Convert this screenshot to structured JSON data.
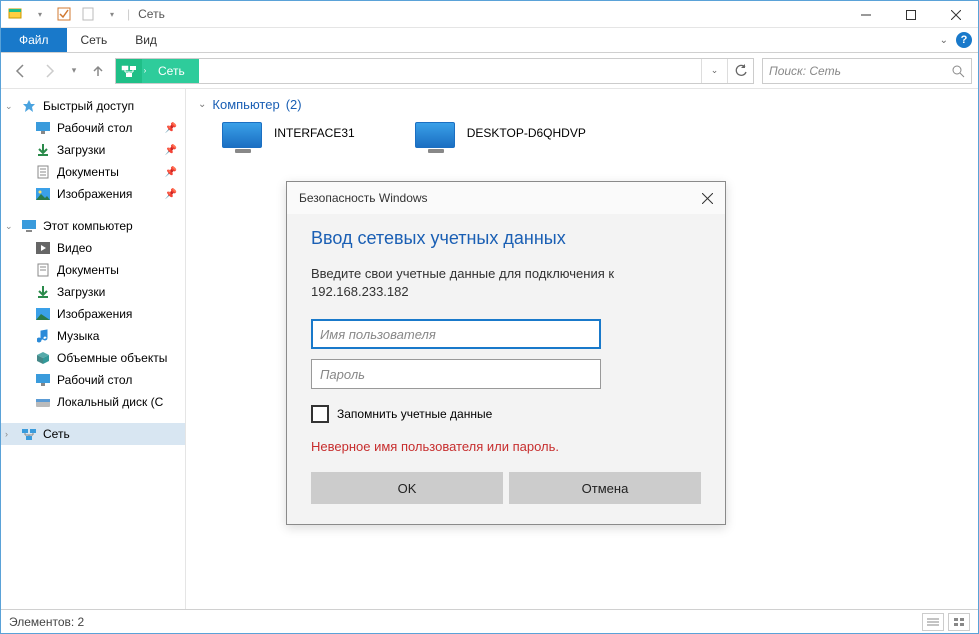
{
  "window": {
    "title": "Сеть"
  },
  "ribbon": {
    "file": "Файл",
    "tabs": [
      "Сеть",
      "Вид"
    ]
  },
  "nav": {
    "address_segment": "Сеть",
    "search_placeholder": "Поиск: Сеть"
  },
  "sidebar": {
    "quick_access": {
      "label": "Быстрый доступ",
      "items": [
        {
          "label": "Рабочий стол",
          "icon": "desktop",
          "pinned": true
        },
        {
          "label": "Загрузки",
          "icon": "download",
          "pinned": true
        },
        {
          "label": "Документы",
          "icon": "document",
          "pinned": true
        },
        {
          "label": "Изображения",
          "icon": "picture",
          "pinned": true
        }
      ]
    },
    "this_pc": {
      "label": "Этот компьютер",
      "items": [
        {
          "label": "Видео",
          "icon": "video"
        },
        {
          "label": "Документы",
          "icon": "document"
        },
        {
          "label": "Загрузки",
          "icon": "download"
        },
        {
          "label": "Изображения",
          "icon": "picture"
        },
        {
          "label": "Музыка",
          "icon": "music"
        },
        {
          "label": "Объемные объекты",
          "icon": "cube"
        },
        {
          "label": "Рабочий стол",
          "icon": "desktop"
        },
        {
          "label": "Локальный диск (C",
          "icon": "disk"
        }
      ]
    },
    "network": {
      "label": "Сеть"
    }
  },
  "main": {
    "category": "Компьютер",
    "category_count": "(2)",
    "computers": [
      {
        "name": "INTERFACE31"
      },
      {
        "name": "DESKTOP-D6QHDVP"
      }
    ]
  },
  "dialog": {
    "title": "Безопасность Windows",
    "heading": "Ввод сетевых учетных данных",
    "instruction_line1": "Введите свои учетные данные для подключения к",
    "instruction_line2": "192.168.233.182",
    "username_placeholder": "Имя пользователя",
    "password_placeholder": "Пароль",
    "remember_label": "Запомнить учетные данные",
    "error": "Неверное имя пользователя или пароль.",
    "ok": "OK",
    "cancel": "Отмена"
  },
  "statusbar": {
    "items_label": "Элементов: 2"
  }
}
